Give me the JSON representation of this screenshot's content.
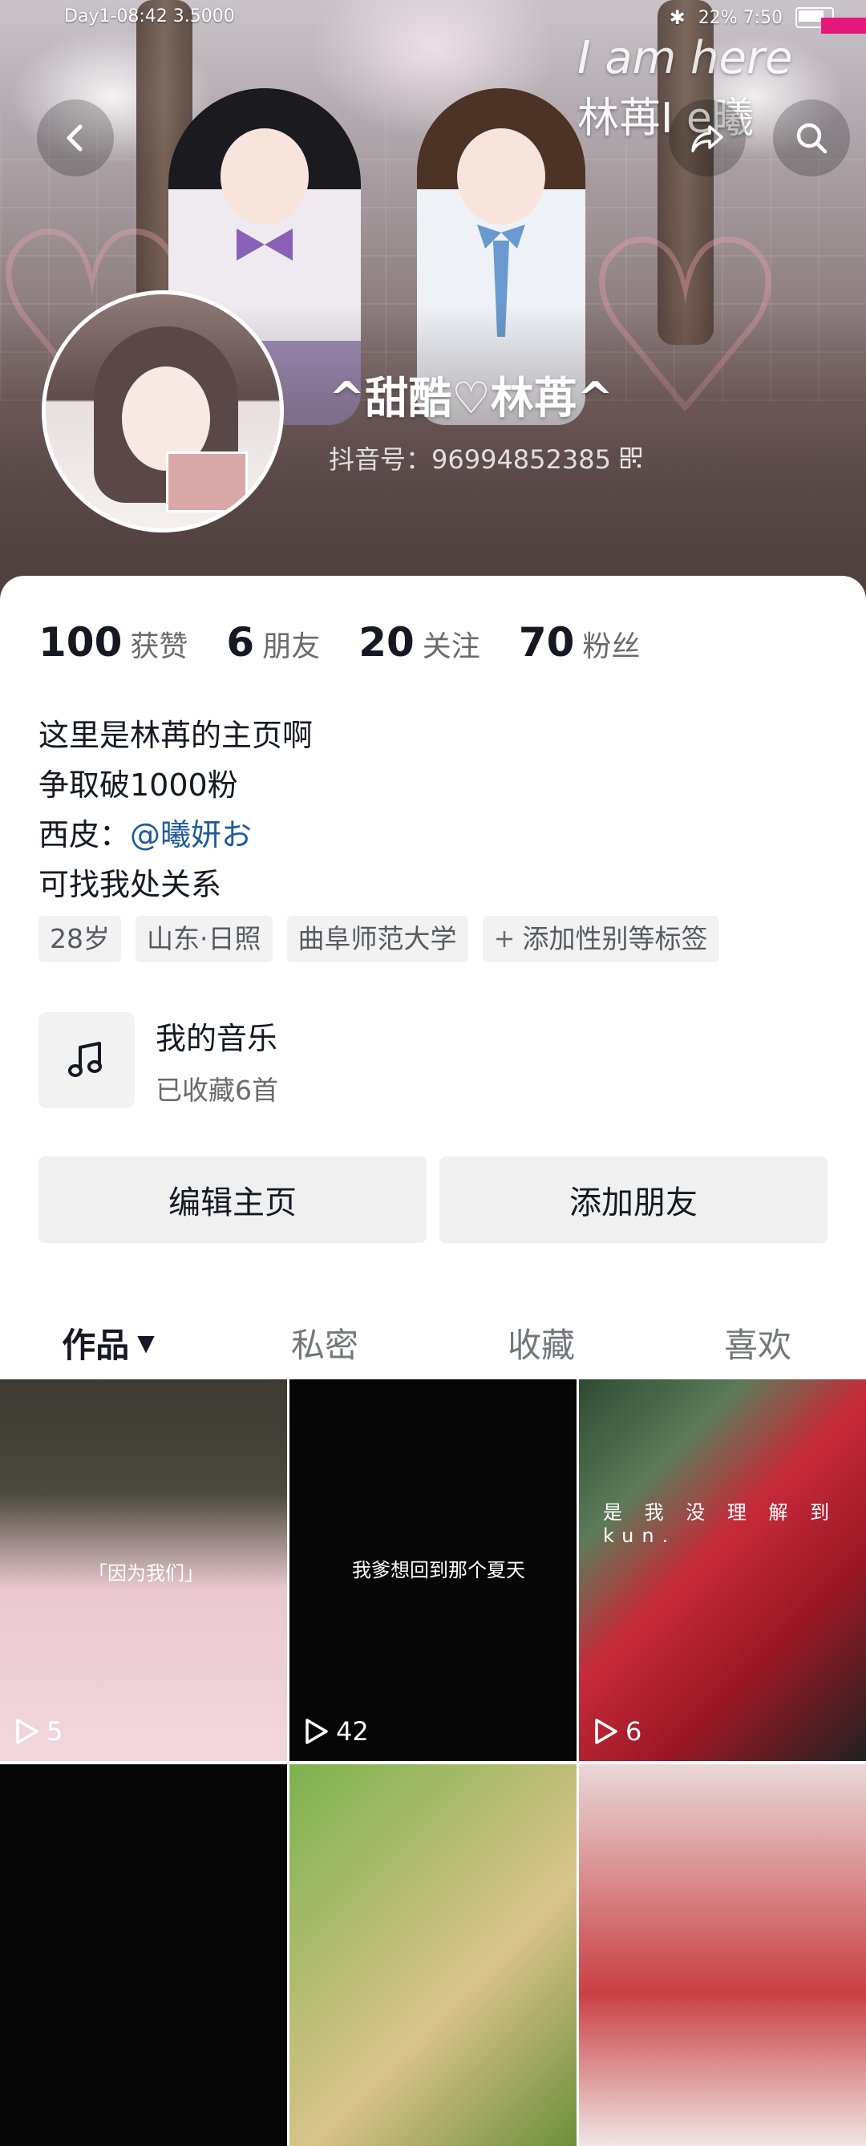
{
  "status_bar": {
    "left_text": "Day1-08:42  3.5000",
    "right_text": "22%  7:50"
  },
  "cover": {
    "overlay_text": "林苒I  e曦",
    "script_text": "I am here"
  },
  "profile": {
    "nickname": "^甜酷♡林苒^",
    "uid_label": "抖音号：96994852385"
  },
  "stats": [
    {
      "num": "100",
      "label": "获赞"
    },
    {
      "num": "6",
      "label": "朋友"
    },
    {
      "num": "20",
      "label": "关注"
    },
    {
      "num": "70",
      "label": "粉丝"
    }
  ],
  "bio": {
    "line1": "这里是林苒的主页啊",
    "line2": "争取破1000粉",
    "line3_prefix": "西皮：",
    "line3_mention": "@曦妍お",
    "line4": "可找我处关系"
  },
  "tags": [
    "28岁",
    "山东·日照",
    "曲阜师范大学",
    "添加性别等标签"
  ],
  "music": {
    "title": "我的音乐",
    "subtitle": "已收藏6首"
  },
  "buttons": {
    "edit": "编辑主页",
    "add_friend": "添加朋友"
  },
  "tabs": [
    {
      "label": "作品",
      "active": true
    },
    {
      "label": "私密",
      "active": false
    },
    {
      "label": "收藏",
      "active": false
    },
    {
      "label": "喜欢",
      "active": false
    }
  ],
  "videos": [
    {
      "caption": "「因为我们」",
      "plays": "5"
    },
    {
      "caption": "我爹想回到那个夏天",
      "plays": "42"
    },
    {
      "caption": "是 我 没 理 解 到 kun.",
      "plays": "6"
    }
  ],
  "icons": {
    "back": "back-arrow-icon",
    "share": "share-icon",
    "search": "search-icon",
    "music": "music-note-icon",
    "play": "play-icon",
    "qr": "qr-code-icon",
    "plus": "plus-icon",
    "caret": "caret-down-icon"
  }
}
